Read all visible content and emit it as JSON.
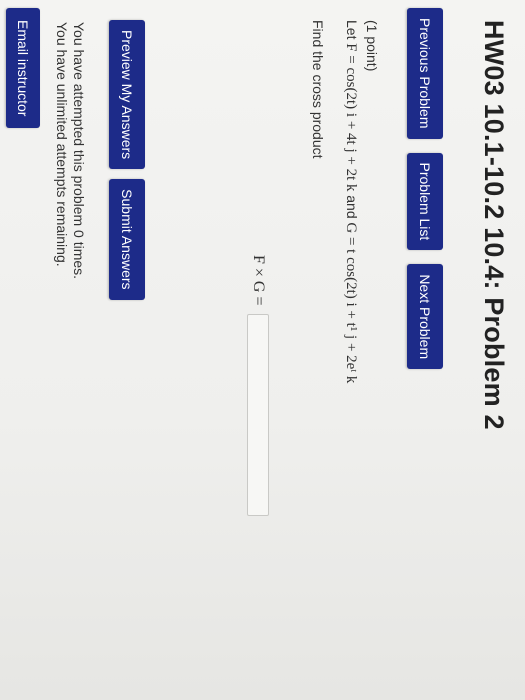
{
  "page": {
    "title": "HW03 10.1-10.2 10.4: Problem 2"
  },
  "nav": {
    "previous": "Previous Problem",
    "list": "Problem List",
    "next": "Next Problem"
  },
  "problem": {
    "points": "(1 point)",
    "let": "Let",
    "f_def": "F = cos(2t) i + 4t j + 2t k",
    "and": "and",
    "g_def": "G = t cos(2t) i + t¹ j + 2eᵗ k",
    "instruction": "Find the cross product"
  },
  "answer": {
    "label": "F × G =",
    "value": ""
  },
  "actions": {
    "preview": "Preview My Answers",
    "submit": "Submit Answers"
  },
  "status": {
    "attempts": "You have attempted this problem 0 times.",
    "remaining": "You have unlimited attempts remaining."
  },
  "email": {
    "label": "Email instructor"
  }
}
